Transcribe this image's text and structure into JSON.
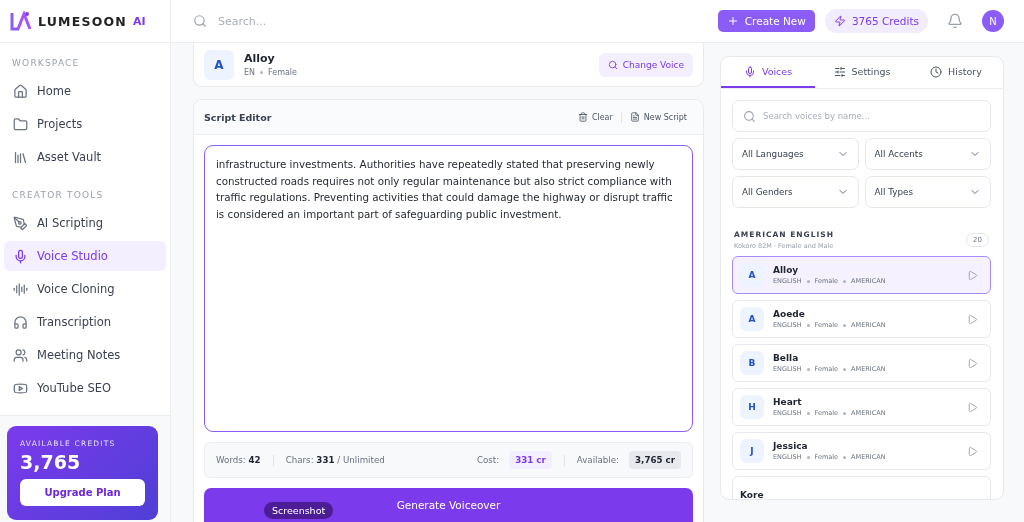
{
  "brand": {
    "name": "LUMESOON",
    "suffix": "AI"
  },
  "header": {
    "search_placeholder": "Search...",
    "create_button": "Create New",
    "credits_pill": "3765 Credits",
    "avatar": "N"
  },
  "sidebar": {
    "sections": [
      {
        "title": "WORKSPACE",
        "items": [
          {
            "label": "Home",
            "selected": false
          },
          {
            "label": "Projects",
            "selected": false
          },
          {
            "label": "Asset Vault",
            "selected": false
          }
        ]
      },
      {
        "title": "CREATOR TOOLS",
        "items": [
          {
            "label": "AI Scripting",
            "selected": false
          },
          {
            "label": "Voice Studio",
            "selected": true
          },
          {
            "label": "Voice Cloning",
            "selected": false
          },
          {
            "label": "Transcription",
            "selected": false
          },
          {
            "label": "Meeting Notes",
            "selected": false
          },
          {
            "label": "YouTube SEO",
            "selected": false
          }
        ]
      }
    ],
    "credits_card": {
      "label": "AVAILABLE CREDITS",
      "amount": "3,765",
      "button": "Upgrade Plan"
    }
  },
  "voice_card": {
    "initial": "A",
    "name": "Alloy",
    "language": "EN",
    "gender": "Female",
    "button": "Change Voice"
  },
  "editor": {
    "title": "Script Editor",
    "actions": [
      "Clear",
      "New Script"
    ],
    "text": "infrastructure investments. Authorities have repeatedly stated that preserving newly constructed roads requires not only regular maintenance but also strict compliance with traffic regulations. Preventing activities that could damage the highway or disrupt traffic is considered an important part of safeguarding public investment.",
    "stats": {
      "words_label": "Words:",
      "words": "42",
      "chars_label": "Chars:",
      "chars": "331",
      "chars_limit": "/ Unlimited",
      "cost_label": "Cost:",
      "cost": "331 cr",
      "available_label": "Available:",
      "available": "3,765 cr"
    },
    "generate_button": "Generate Voiceover",
    "tooltip": "Screenshot"
  },
  "panel": {
    "tabs": [
      {
        "label": "Voices",
        "selected": true
      },
      {
        "label": "Settings",
        "selected": false
      },
      {
        "label": "History",
        "selected": false
      }
    ],
    "search_placeholder": "Search voices by name...",
    "filters": [
      "All Languages",
      "All Accents",
      "All Genders",
      "All Types"
    ],
    "group": {
      "title": "AMERICAN ENGLISH",
      "subtitle": "Kokoro 82M · Female and Male",
      "count": "20"
    },
    "voices": [
      {
        "initial": "A",
        "name": "Alloy",
        "language": "ENGLISH",
        "gender": "Female",
        "accent": "AMERICAN",
        "selected": true
      },
      {
        "initial": "A",
        "name": "Aoede",
        "language": "ENGLISH",
        "gender": "Female",
        "accent": "AMERICAN",
        "selected": false
      },
      {
        "initial": "B",
        "name": "Bella",
        "language": "ENGLISH",
        "gender": "Female",
        "accent": "AMERICAN",
        "selected": false
      },
      {
        "initial": "H",
        "name": "Heart",
        "language": "ENGLISH",
        "gender": "Female",
        "accent": "AMERICAN",
        "selected": false
      },
      {
        "initial": "J",
        "name": "Jessica",
        "language": "ENGLISH",
        "gender": "Female",
        "accent": "AMERICAN",
        "selected": false
      },
      {
        "name": "Kore",
        "selected": false
      }
    ]
  }
}
